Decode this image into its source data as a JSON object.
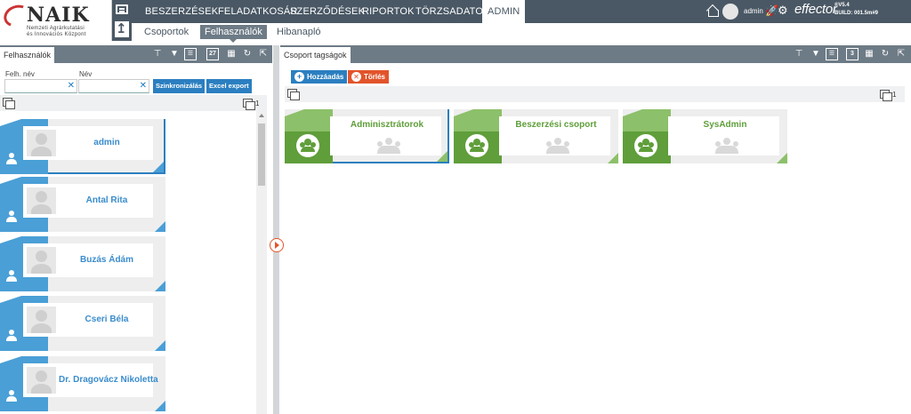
{
  "logo": {
    "main": "NAIK",
    "sub1": "Nemzeti Agrárkutatási",
    "sub2": "és Innovációs Központ"
  },
  "nav": {
    "items": [
      "BESZERZÉSEK",
      "FELADATKOSÁR",
      "SZERZŐDÉSEK",
      "RIPORTOK",
      "TÖRZSADATOK",
      "ADMIN"
    ],
    "active": "ADMIN"
  },
  "header": {
    "username": "admin",
    "brand": "effector",
    "version": "®V5.4",
    "build": "BUILD: 001.5m#9",
    "icons": [
      "home-icon",
      "rocket-icon",
      "gear-icon"
    ]
  },
  "subnav": {
    "items": [
      "Csoportok",
      "Felhasználók",
      "Hibanapló"
    ],
    "active": "Felhasználók"
  },
  "left_panel": {
    "tab": "Felhasználók",
    "filters": {
      "username_label": "Felh. név",
      "username_value": "",
      "name_label": "Név",
      "name_value": "",
      "clear_symbol": "✕",
      "sync_button": "Szinkronizálás",
      "export_button": "Excel export"
    },
    "count": "1",
    "users": [
      {
        "name": "admin",
        "selected": true
      },
      {
        "name": "Antal Rita",
        "selected": false
      },
      {
        "name": "Buzás Ádám",
        "selected": false
      },
      {
        "name": "Cseri Béla",
        "selected": false
      },
      {
        "name": "Dr. Dragovácz Nikoletta",
        "selected": false
      }
    ]
  },
  "right_panel": {
    "tab": "Csoport tagságok",
    "add_button": "Hozzáadás",
    "delete_button": "Törlés",
    "count": "1",
    "groups": [
      {
        "name": "Adminisztrátorok",
        "selected": true
      },
      {
        "name": "Beszerzési csoport",
        "selected": false
      },
      {
        "name": "SysAdmin",
        "selected": false
      }
    ]
  },
  "toolbar_labels": {
    "calendar": "27",
    "calendar_right": "3"
  },
  "colors": {
    "nav_bg": "#4a5865",
    "panel_header": "#6d7b86",
    "user_accent": "#4a9fd6",
    "group_accent": "#5f9e3a",
    "add": "#2b7fc0",
    "delete": "#e2542b"
  }
}
